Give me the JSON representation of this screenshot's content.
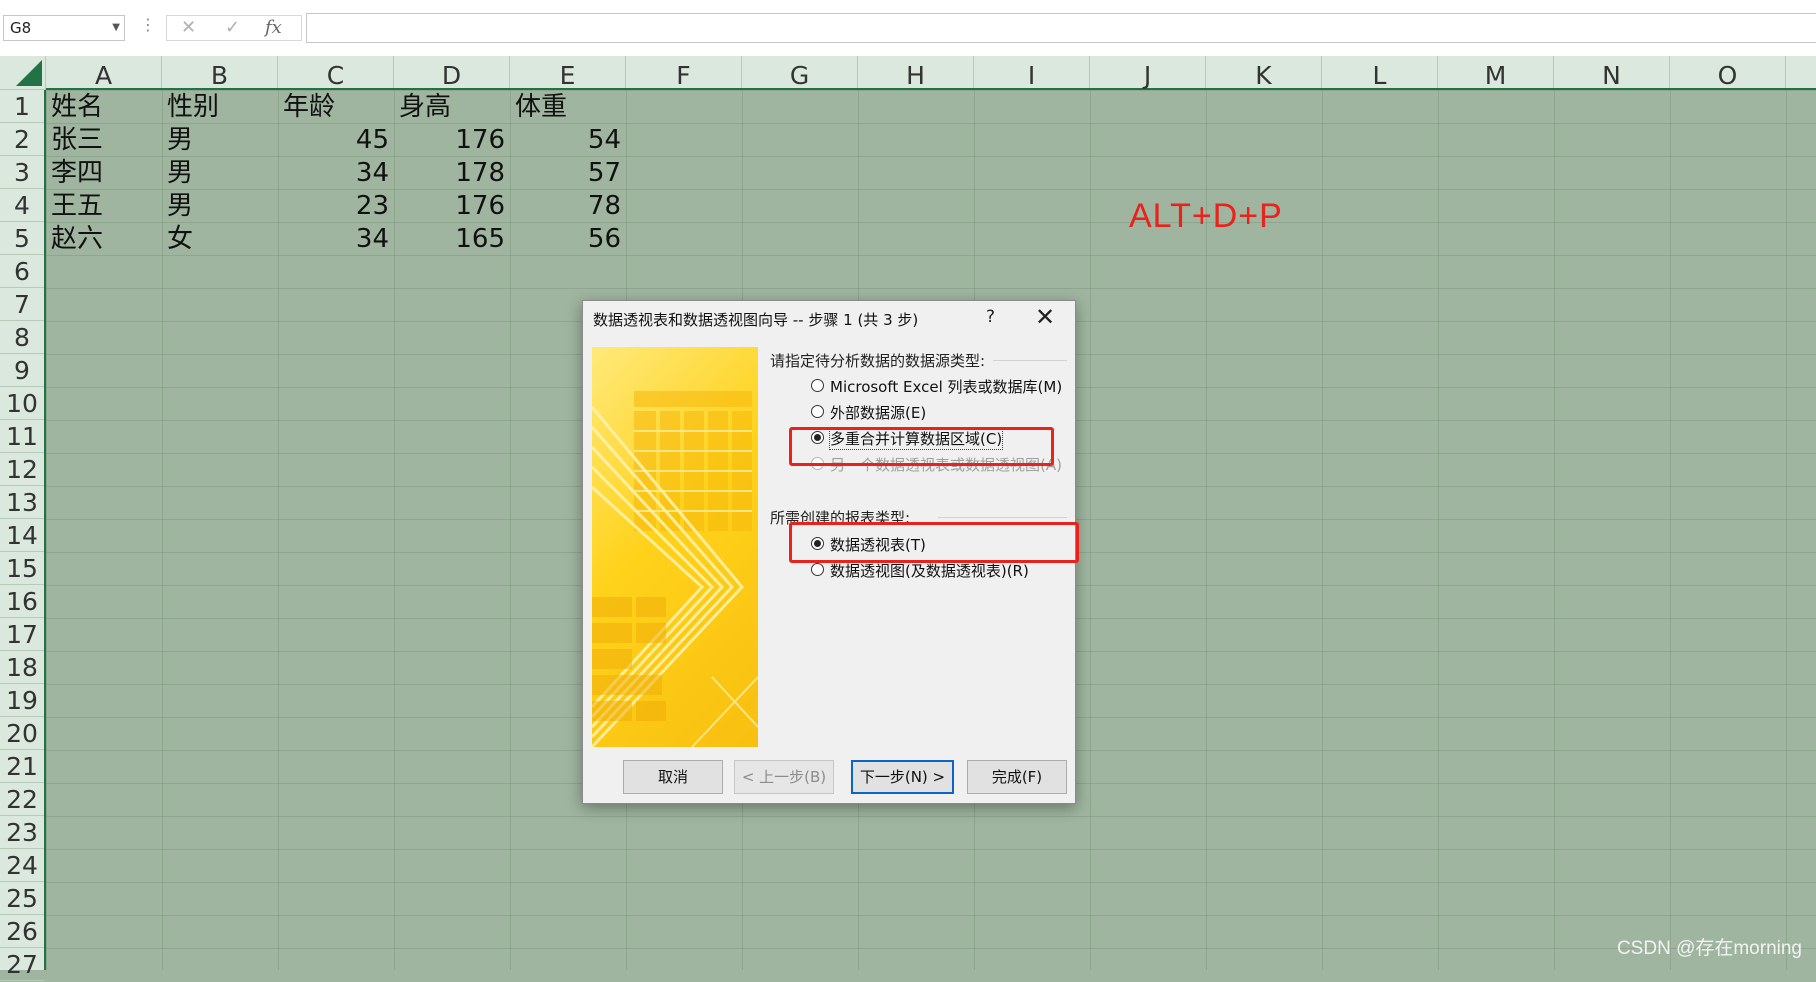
{
  "formula_bar": {
    "name_box": "G8",
    "dots": "⋮",
    "cancel_glyph": "✕",
    "enter_glyph": "✓",
    "fx_glyph": "fx",
    "formula": ""
  },
  "columns": [
    "A",
    "B",
    "C",
    "D",
    "E",
    "F",
    "G",
    "H",
    "I",
    "J",
    "K",
    "L",
    "M",
    "N",
    "O"
  ],
  "rows": [
    "1",
    "2",
    "3",
    "4",
    "5",
    "6",
    "7",
    "8",
    "9",
    "10",
    "11",
    "12",
    "13",
    "14",
    "15",
    "16",
    "17",
    "18",
    "19",
    "20",
    "21",
    "22",
    "23",
    "24",
    "25",
    "26",
    "27"
  ],
  "sheet": {
    "header": [
      "姓名",
      "性别",
      "年龄",
      "身高",
      "体重"
    ],
    "data": [
      [
        "张三",
        "男",
        "45",
        "176",
        "54"
      ],
      [
        "李四",
        "男",
        "34",
        "178",
        "57"
      ],
      [
        "王五",
        "男",
        "23",
        "176",
        "78"
      ],
      [
        "赵六",
        "女",
        "34",
        "165",
        "56"
      ]
    ]
  },
  "annotation": "ALT+D+P",
  "watermark": "CSDN @存在morning",
  "dialog": {
    "title": "数据透视表和数据透视图向导 -- 步骤 1 (共 3 步)",
    "help": "?",
    "close": "✕",
    "source_label": "请指定待分析数据的数据源类型:",
    "source_options": [
      {
        "label": "Microsoft Excel 列表或数据库(M)",
        "selected": false,
        "disabled": false
      },
      {
        "label": "外部数据源(E)",
        "selected": false,
        "disabled": false
      },
      {
        "label": "多重合并计算数据区域(C)",
        "selected": true,
        "disabled": false
      },
      {
        "label": "另一个数据透视表或数据透视图(A)",
        "selected": false,
        "disabled": true
      }
    ],
    "report_label": "所需创建的报表类型:",
    "report_options": [
      {
        "label": "数据透视表(T)",
        "selected": true
      },
      {
        "label": "数据透视图(及数据透视表)(R)",
        "selected": false
      }
    ],
    "buttons": {
      "cancel": "取消",
      "back": "< 上一步(B)",
      "next": "下一步(N) >",
      "finish": "完成(F)"
    },
    "highlight_color": "#e8221c"
  }
}
